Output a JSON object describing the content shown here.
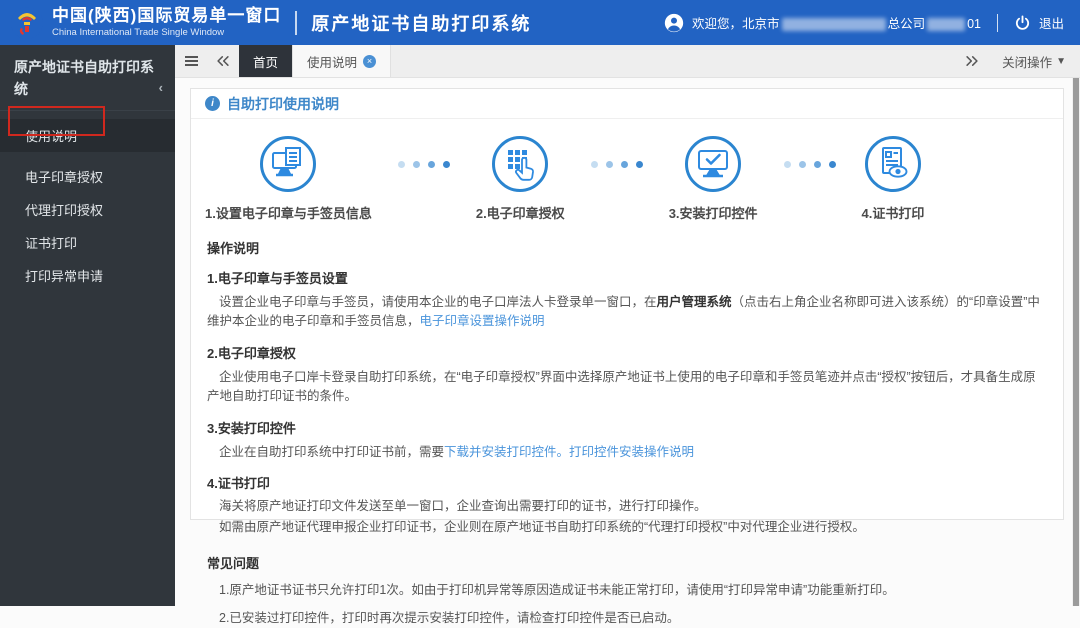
{
  "header": {
    "brand_cn": "中国(陕西)国际贸易单一窗口",
    "brand_en": "China International Trade Single Window",
    "app_title": "原产地证书自助打印系统",
    "welcome_prefix": "欢迎您，北京市",
    "welcome_mid": "总公司",
    "welcome_suffix": "01",
    "logout_label": "退出"
  },
  "sidebar": {
    "title": "原产地证书自助打印系统",
    "collapse_icon": "‹",
    "items": [
      {
        "label": "使用说明"
      },
      {
        "label": "电子印章授权"
      },
      {
        "label": "代理打印授权"
      },
      {
        "label": "证书打印"
      },
      {
        "label": "打印异常申请"
      }
    ]
  },
  "tabbar": {
    "home_tab": "首页",
    "active_tab": "使用说明",
    "close_ops_label": "关闭操作"
  },
  "panel": {
    "title": "自助打印使用说明",
    "steps": [
      {
        "label": "1.设置电子印章与手签员信息",
        "icon": "monitor-document-icon"
      },
      {
        "label": "2.电子印章授权",
        "icon": "keypad-hand-icon"
      },
      {
        "label": "3.安装打印控件",
        "icon": "monitor-check-icon"
      },
      {
        "label": "4.证书打印",
        "icon": "document-eye-icon"
      }
    ],
    "sections": {
      "ops_title": "操作说明",
      "s1_title": "1.电子印章与手签员设置",
      "s1_text_a": "设置企业电子印章与手签员，请使用本企业的电子口岸法人卡登录单一窗口，在",
      "s1_bold": "用户管理系统",
      "s1_text_b": "（点击右上角企业名称即可进入该系统）的“印章设置”中维护本企业的电子印章和手签员信息，",
      "s1_link": "电子印章设置操作说明",
      "s2_title": "2.电子印章授权",
      "s2_text": "企业使用电子口岸卡登录自助打印系统，在“电子印章授权”界面中选择原产地证书上使用的电子印章和手签员笔迹并点击“授权”按钮后，才具备生成原产地自助打印证书的条件。",
      "s3_title": "3.安装打印控件",
      "s3_text_a": "企业在自助打印系统中打印证书前，需要",
      "s3_link1": "下载并安装打印控件。",
      "s3_link2": "打印控件安装操作说明",
      "s4_title": "4.证书打印",
      "s4_text1": "海关将原产地证打印文件发送至单一窗口，企业查询出需要打印的证书，进行打印操作。",
      "s4_text2": "如需由原产地证代理申报企业打印证书，企业则在原产地证书自助打印系统的“代理打印授权”中对代理企业进行授权。",
      "faq_title": "常见问题",
      "faq_1": "1.原产地证书证书只允许打印1次。如由于打印机异常等原因造成证书未能正常打印，请使用“打印异常申请”功能重新打印。",
      "faq_2": "2.已安装过打印控件，打印时再次提示安装打印控件，请检查打印控件是否已启动。"
    }
  },
  "colors": {
    "header_blue": "#2263c3",
    "sidebar_dark": "#30363c",
    "accent_blue": "#2e8ae0",
    "link_blue": "#4a94db",
    "annotation_red": "#d0281e"
  }
}
